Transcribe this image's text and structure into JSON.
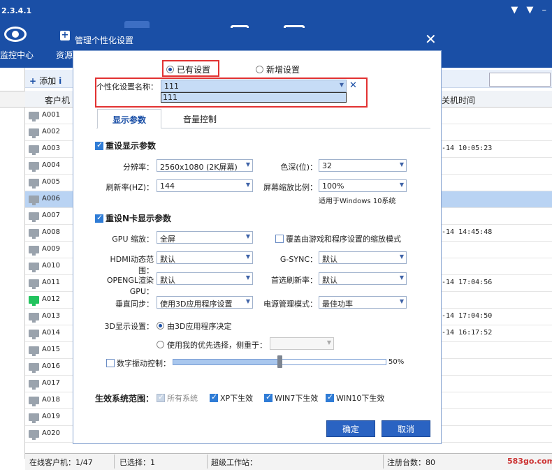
{
  "app": {
    "version": "2.3.4.1",
    "top_right_icons": "▼ ▼ –",
    "nav": [
      {
        "label": "监控中心"
      },
      {
        "label": "资源"
      }
    ]
  },
  "toolbar": {
    "add_label": "添加",
    "mark": "i"
  },
  "grid": {
    "headers": [
      "客户机",
      "关机时间"
    ],
    "rows": [
      {
        "id": "A001",
        "time": "",
        "online": false,
        "selected": false
      },
      {
        "id": "A002",
        "time": "",
        "online": false,
        "selected": false
      },
      {
        "id": "A003",
        "time": "-14 10:05:23",
        "online": false,
        "selected": false
      },
      {
        "id": "A004",
        "time": "",
        "online": false,
        "selected": false
      },
      {
        "id": "A005",
        "time": "",
        "online": false,
        "selected": false
      },
      {
        "id": "A006",
        "time": "",
        "online": false,
        "selected": true
      },
      {
        "id": "A007",
        "time": "",
        "online": false,
        "selected": false
      },
      {
        "id": "A008",
        "time": "-14 14:45:48",
        "online": false,
        "selected": false
      },
      {
        "id": "A009",
        "time": "",
        "online": false,
        "selected": false
      },
      {
        "id": "A010",
        "time": "",
        "online": false,
        "selected": false
      },
      {
        "id": "A011",
        "time": "-14 17:04:56",
        "online": false,
        "selected": false
      },
      {
        "id": "A012",
        "time": "",
        "online": true,
        "selected": false
      },
      {
        "id": "A013",
        "time": "-14 17:04:50",
        "online": false,
        "selected": false
      },
      {
        "id": "A014",
        "time": "-14 16:17:52",
        "online": false,
        "selected": false
      },
      {
        "id": "A015",
        "time": "",
        "online": false,
        "selected": false
      },
      {
        "id": "A016",
        "time": "",
        "online": false,
        "selected": false
      },
      {
        "id": "A017",
        "time": "",
        "online": false,
        "selected": false
      },
      {
        "id": "A018",
        "time": "",
        "online": false,
        "selected": false
      },
      {
        "id": "A019",
        "time": "",
        "online": false,
        "selected": false
      },
      {
        "id": "A020",
        "time": "",
        "online": false,
        "selected": false
      }
    ]
  },
  "status": {
    "online": "在线客户机：1/47",
    "selected": "已选择：1",
    "super_ws": "超级工作站：",
    "registered": "注册台数：80",
    "watermark": "583go.com"
  },
  "dialog": {
    "title": "管理个性化设置",
    "mode_existing": "已有设置",
    "mode_new": "新增设置",
    "name_label": "个性化设置名称：",
    "name_value": "111",
    "name_option": "111",
    "tab_display": "显示参数",
    "tab_volume": "音量控制",
    "reset_display": "重设显示参数",
    "resolution_label": "分辨率：",
    "resolution_value": "2560x1080 (2K屏幕)",
    "color_depth_label": "色深(位)：",
    "color_depth_value": "32",
    "refresh_label": "刷新率(HZ)：",
    "refresh_value": "144",
    "scale_label": "屏幕缩放比例：",
    "scale_value": "100%",
    "scale_note": "适用于Windows 10系统",
    "reset_nvidia": "重设N卡显示参数",
    "gpu_scale_label": "GPU 缩放：",
    "gpu_scale_value": "全屏",
    "override_scaling": "覆盖由游戏和程序设置的缩放模式",
    "hdmi_label": "HDMI动态范围：",
    "hdmi_value": "默认",
    "gsync_label": "G-SYNC：",
    "gsync_value": "默认",
    "opengl_label": "OPENGL渲染GPU：",
    "opengl_value": "默认",
    "pref_refresh_label": "首选刷新率：",
    "pref_refresh_value": "默认",
    "vsync_label": "垂直同步：",
    "vsync_value": "使用3D应用程序设置",
    "power_label": "电源管理模式：",
    "power_value": "最佳功率",
    "d3_label": "3D显示设置：",
    "d3_opt1": "由3D应用程序决定",
    "d3_opt2": "使用我的优先选择，侧重于：",
    "vibrance_label": "数字振动控制：",
    "vibrance_value": "50%",
    "vibrance_fraction": 0.5,
    "scope_label": "生效系统范围：",
    "scope_all": "所有系统",
    "scope_xp": "XP下生效",
    "scope_win7": "WIN7下生效",
    "scope_win10": "WIN10下生效",
    "ok": "确定",
    "cancel": "取消"
  },
  "colors": {
    "brand": "#1a4fa6",
    "highlight": "#e23232",
    "online": "#22c35e"
  }
}
